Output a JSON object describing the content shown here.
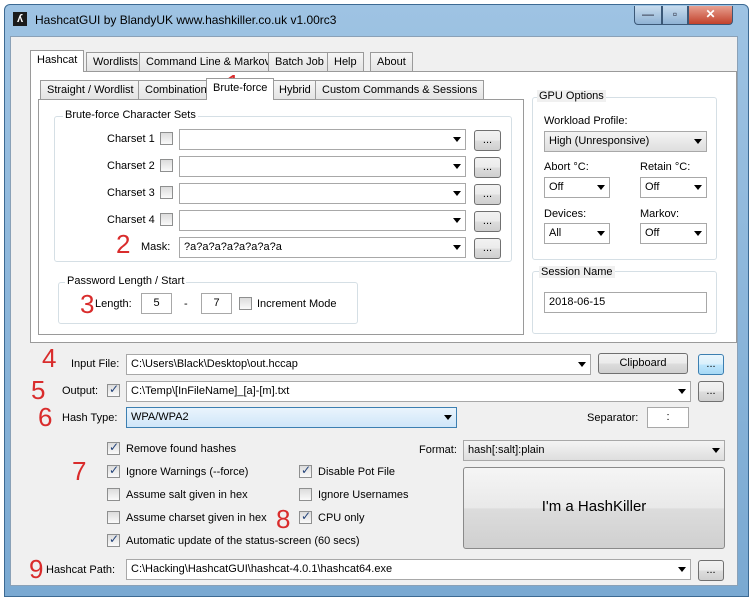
{
  "window": {
    "title": "HashcatGUI by BlandyUK www.hashkiller.co.uk v1.00rc3",
    "icon_letter": "ʎ",
    "min_label": "—",
    "max_label": "▫",
    "close_label": "✕"
  },
  "main_tabs": [
    "Hashcat",
    "Wordlists",
    "Command Line & Markov",
    "Batch Job",
    "Help",
    "About"
  ],
  "sub_tabs": [
    "Straight / Wordlist",
    "Combination",
    "Brute-force",
    "Hybrid",
    "Custom Commands & Sessions"
  ],
  "bruteforce": {
    "group_title": "Brute-force Character Sets",
    "charsets": [
      {
        "label": "Charset 1",
        "checked": false,
        "value": ""
      },
      {
        "label": "Charset 2",
        "checked": false,
        "value": ""
      },
      {
        "label": "Charset 3",
        "checked": false,
        "value": ""
      },
      {
        "label": "Charset 4",
        "checked": false,
        "value": ""
      }
    ],
    "browse_label": "...",
    "mask_label": "Mask:",
    "mask_value": "?a?a?a?a?a?a?a?a"
  },
  "password_length": {
    "group_title": "Password Length / Start",
    "length_label": "Length:",
    "min": "5",
    "dash": "-",
    "max": "7",
    "increment_label": "Increment Mode",
    "increment_checked": false
  },
  "gpu_options": {
    "group_title": "GPU Options",
    "workload_label": "Workload Profile:",
    "workload_value": "High (Unresponsive)",
    "abort_label": "Abort °C:",
    "abort_value": "Off",
    "retain_label": "Retain °C:",
    "retain_value": "Off",
    "devices_label": "Devices:",
    "devices_value": "All",
    "markov_label": "Markov:",
    "markov_value": "Off"
  },
  "session": {
    "group_title": "Session Name",
    "value": "2018-06-15"
  },
  "input_file": {
    "label": "Input File:",
    "value": "C:\\Users\\Black\\Desktop\\out.hccap",
    "clipboard_label": "Clipboard",
    "browse_label": "..."
  },
  "output": {
    "label": "Output:",
    "checked": true,
    "value": "C:\\Temp\\[InFileName]_[a]-[m].txt",
    "browse_label": "..."
  },
  "hash_type": {
    "label": "Hash Type:",
    "value": "WPA/WPA2",
    "separator_label": "Separator:",
    "separator_value": ":"
  },
  "options": {
    "remove_found": {
      "label": "Remove found hashes",
      "checked": true
    },
    "ignore_warnings": {
      "label": "Ignore Warnings (--force)",
      "checked": true
    },
    "salt_hex": {
      "label": "Assume salt given in hex",
      "checked": false
    },
    "charset_hex": {
      "label": "Assume charset given in hex",
      "checked": false
    },
    "auto_update": {
      "label": "Automatic update of the status-screen (60 secs)",
      "checked": true
    },
    "disable_pot": {
      "label": "Disable Pot File",
      "checked": true
    },
    "ignore_usernames": {
      "label": "Ignore Usernames",
      "checked": false
    },
    "cpu_only": {
      "label": "CPU only",
      "checked": true
    }
  },
  "format": {
    "label": "Format:",
    "value": "hash[:salt]:plain"
  },
  "start_button_label": "I'm a HashKiller",
  "hashcat_path": {
    "label": "Hashcat Path:",
    "value": "C:\\Hacking\\HashcatGUI\\hashcat-4.0.1\\hashcat64.exe",
    "browse_label": "..."
  },
  "annotations": [
    "1",
    "2",
    "3",
    "4",
    "5",
    "6",
    "7",
    "8",
    "9"
  ],
  "colors": {
    "annotation": "#d92c2c",
    "title_bar": "#9ec3e3",
    "highlight_border": "#3c7fb1"
  }
}
